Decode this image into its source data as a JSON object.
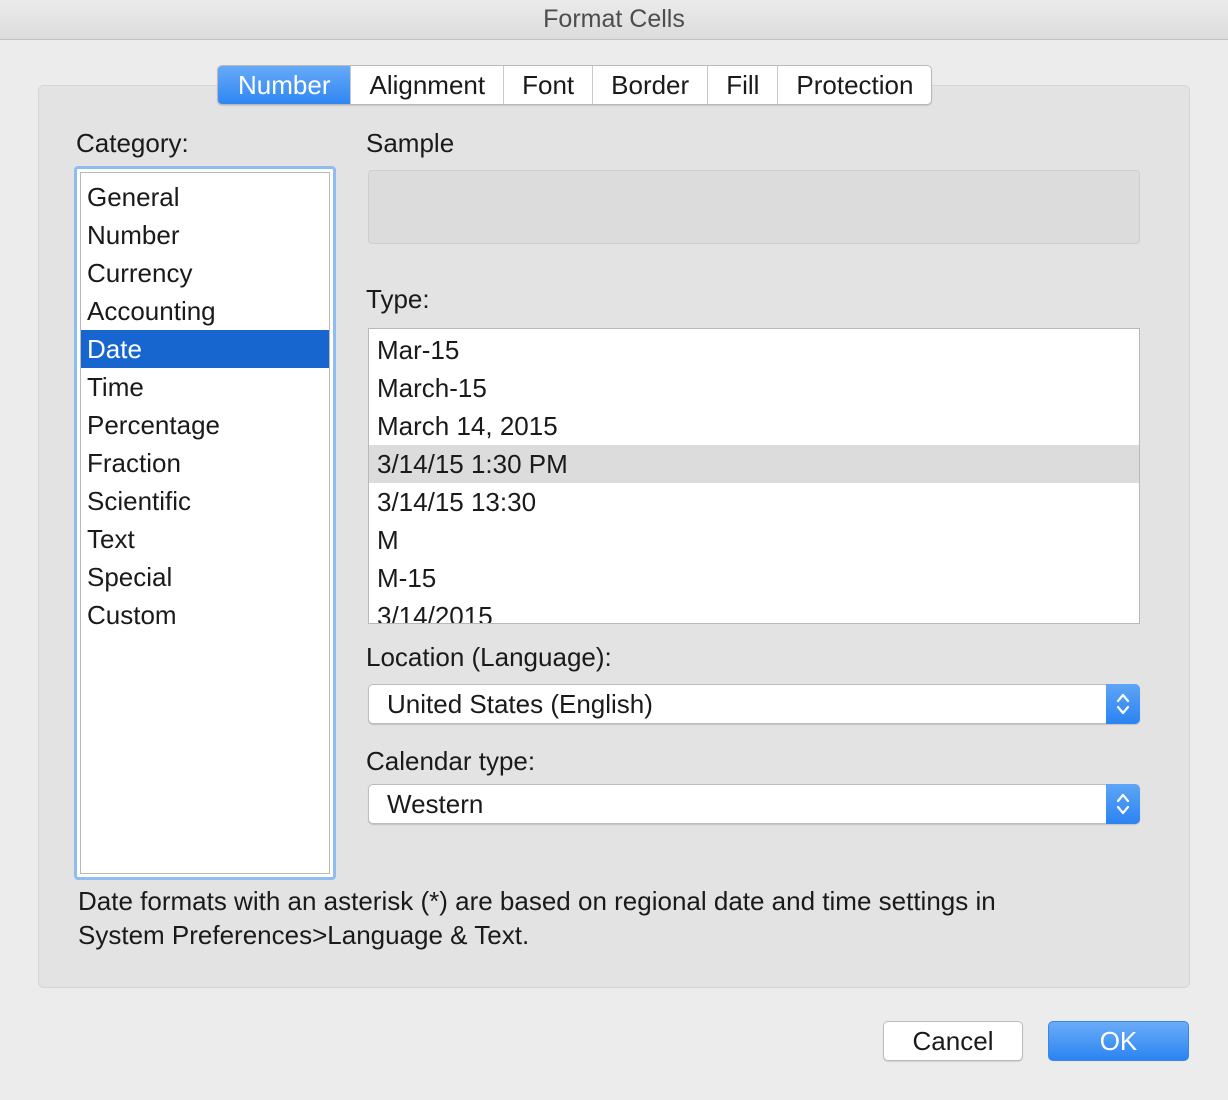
{
  "window": {
    "title": "Format Cells"
  },
  "tabs": [
    {
      "label": "Number",
      "active": true
    },
    {
      "label": "Alignment",
      "active": false
    },
    {
      "label": "Font",
      "active": false
    },
    {
      "label": "Border",
      "active": false
    },
    {
      "label": "Fill",
      "active": false
    },
    {
      "label": "Protection",
      "active": false
    }
  ],
  "category": {
    "label": "Category:",
    "selected": "Date",
    "items": [
      "General",
      "Number",
      "Currency",
      "Accounting",
      "Date",
      "Time",
      "Percentage",
      "Fraction",
      "Scientific",
      "Text",
      "Special",
      "Custom"
    ]
  },
  "sample": {
    "label": "Sample",
    "value": ""
  },
  "type": {
    "label": "Type:",
    "selected": "3/14/15 1:30 PM",
    "items": [
      "Mar-15",
      "March-15",
      "March 14, 2015",
      "3/14/15 1:30 PM",
      "3/14/15 13:30",
      "M",
      "M-15",
      "3/14/2015"
    ]
  },
  "location": {
    "label": "Location (Language):",
    "value": "United States (English)"
  },
  "calendar": {
    "label": "Calendar type:",
    "value": "Western"
  },
  "note": {
    "line1": "Date formats with an asterisk (*) are based on regional date and time settings in",
    "line2": "System Preferences>Language & Text."
  },
  "buttons": {
    "cancel": "Cancel",
    "ok": "OK"
  },
  "colors": {
    "accent": "#2f86f3",
    "selection": "#1765cf",
    "focus_ring": "#8fbdf1"
  }
}
